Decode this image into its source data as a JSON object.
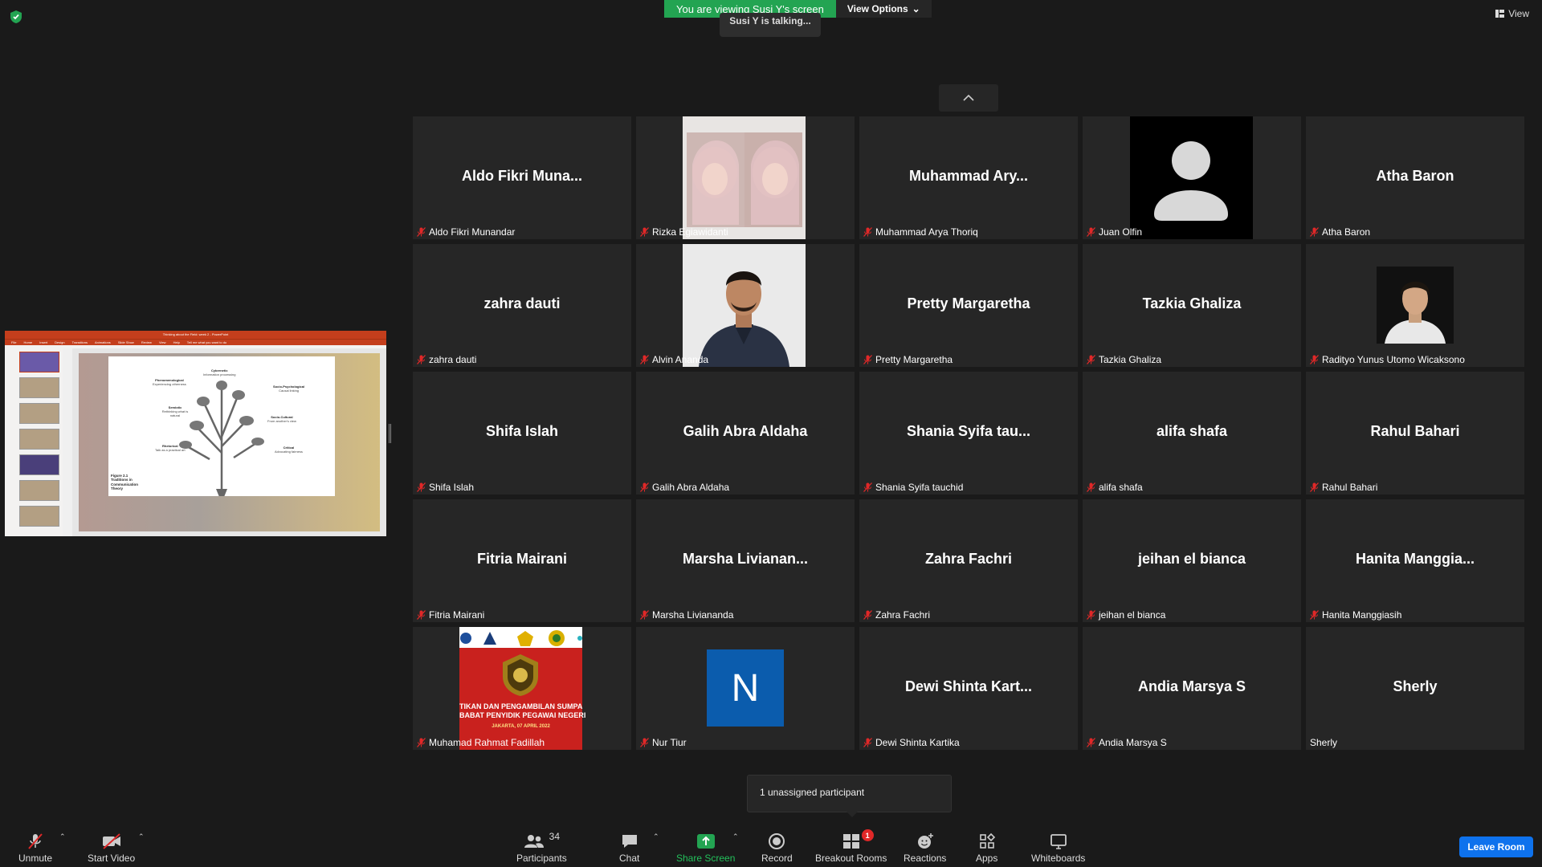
{
  "banner": {
    "viewing": "You are viewing Susi Y's screen",
    "view_options": "View Options"
  },
  "talking": "Susi Y is talking...",
  "view_button": "View",
  "share": {
    "ppt_title": "Thinking about the Field: week 2 - PowerPoint",
    "menu": [
      "File",
      "Home",
      "Insert",
      "Design",
      "Transitions",
      "Animations",
      "Slide Show",
      "Review",
      "View",
      "Help",
      "Tell me what you want to do"
    ],
    "slide": {
      "labels": {
        "cybernetic": "Cybernetic",
        "cybernetic_sub": "Information processing",
        "phenomenological": "Phenomenological",
        "phenomenological_sub": "Experiencing otherness",
        "socio_psych": "Socio-Psychological",
        "socio_psych_sub": "Causal linking",
        "semiotic": "Semiotic",
        "semiotic_sub": "Rethinking what is natural",
        "socio_cultural": "Socio-Cultural",
        "socio_cultural_sub": "From another's view",
        "rhetorical": "Rhetorical",
        "rhetorical_sub": "Talk as a practical art",
        "critical": "Critical",
        "critical_sub": "Advocating fairness"
      },
      "figure": "Figure 2.1 Traditions in Communication Theory"
    }
  },
  "tiles": [
    {
      "big": "Aldo  Fikri  Muna...",
      "label": "Aldo Fikri Munandar",
      "muted": true
    },
    {
      "big": "",
      "label": "Rizka Egiawidanti",
      "muted": true,
      "photo": "selfie"
    },
    {
      "big": "Muhammad  Ary...",
      "label": "Muhammad Arya Thoriq",
      "muted": true
    },
    {
      "big": "",
      "label": "Juan Olfin",
      "muted": true,
      "photo": "avatar"
    },
    {
      "big": "Atha Baron",
      "label": "Atha Baron",
      "muted": true
    },
    {
      "big": "zahra dauti",
      "label": "zahra dauti",
      "muted": true
    },
    {
      "big": "",
      "label": "Alvin Ananda",
      "muted": true,
      "photo": "man"
    },
    {
      "big": "Pretty Margaretha",
      "label": "Pretty Margaretha",
      "muted": true
    },
    {
      "big": "Tazkia Ghaliza",
      "label": "Tazkia Ghaliza",
      "muted": true
    },
    {
      "big": "",
      "label": "Radityo Yunus Utomo Wicaksono",
      "muted": true,
      "photo": "portrait"
    },
    {
      "big": "Shifa Islah",
      "label": "Shifa Islah",
      "muted": true
    },
    {
      "big": "Galih Abra Aldaha",
      "label": "Galih Abra Aldaha",
      "muted": true
    },
    {
      "big": "Shania  Syifa  tau...",
      "label": "Shania Syifa tauchid",
      "muted": true
    },
    {
      "big": "alifa shafa",
      "label": "alifa shafa",
      "muted": true
    },
    {
      "big": "Rahul Bahari",
      "label": "Rahul Bahari",
      "muted": true
    },
    {
      "big": "Fitria Mairani",
      "label": "Fitria Mairani",
      "muted": true
    },
    {
      "big": "Marsha  Livianan...",
      "label": "Marsha Liviananda",
      "muted": true
    },
    {
      "big": "Zahra Fachri",
      "label": "Zahra Fachri",
      "muted": true
    },
    {
      "big": "jeihan el bianca",
      "label": "jeihan el bianca",
      "muted": true
    },
    {
      "big": "Hanita  Manggia...",
      "label": "Hanita Manggiasih",
      "muted": true
    },
    {
      "big": "",
      "label": "Muhamad Rahmat Fadillah",
      "muted": true,
      "photo": "banner"
    },
    {
      "big": "",
      "label": "Nur Tiur",
      "muted": true,
      "photo": "initial",
      "initial": "N"
    },
    {
      "big": "Dewi  Shinta  Kart...",
      "label": "Dewi Shinta Kartika",
      "muted": true
    },
    {
      "big": "Andia Marsya S",
      "label": "Andia Marsya S",
      "muted": true
    },
    {
      "big": "Sherly",
      "label": "Sherly",
      "muted": false
    }
  ],
  "banner_photo": {
    "line1": "TIKAN DAN PENGAMBILAN SUMPA",
    "line2": "BABAT PENYIDIK PEGAWAI NEGERI",
    "line3": "JAKARTA, 07 APRIL 2022"
  },
  "unassigned": "1 unassigned participant",
  "toolbar": {
    "unmute": "Unmute",
    "start_video": "Start Video",
    "participants": "Participants",
    "participants_count": "34",
    "chat": "Chat",
    "share_screen": "Share Screen",
    "record": "Record",
    "breakout_rooms": "Breakout Rooms",
    "breakout_badge": "1",
    "reactions": "Reactions",
    "apps": "Apps",
    "whiteboards": "Whiteboards",
    "leave": "Leave Room"
  },
  "colors": {
    "share_green": "#23a452",
    "leave_blue": "#0e72ed",
    "tile_bg": "#262626",
    "muted_red": "#e02828"
  }
}
